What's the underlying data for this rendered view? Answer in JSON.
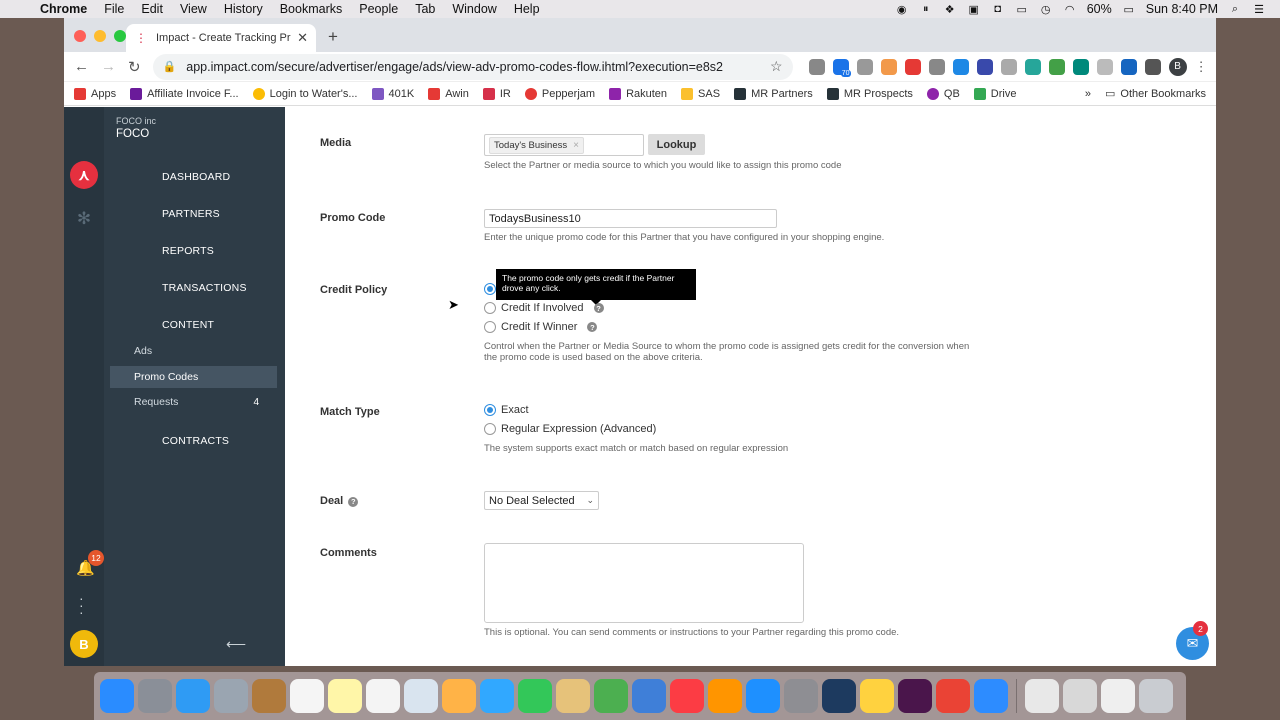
{
  "menubar": {
    "app": "Chrome",
    "items": [
      "File",
      "Edit",
      "View",
      "History",
      "Bookmarks",
      "People",
      "Tab",
      "Window",
      "Help"
    ],
    "battery": "60%",
    "clock": "Sun 8:40 PM"
  },
  "browser": {
    "tab_title": "Impact - Create Tracking Prom",
    "url": "app.impact.com/secure/advertiser/engage/ads/view-adv-promo-codes-flow.ihtml?execution=e8s2",
    "ext_badge": "70",
    "profile_initial": "B",
    "bookmarks": [
      "Apps",
      "Affiliate Invoice F...",
      "Login to Water's...",
      "401K",
      "Awin",
      "IR",
      "Pepperjam",
      "Rakuten",
      "SAS",
      "MR Partners",
      "MR Prospects",
      "QB",
      "Drive"
    ],
    "more_bookmarks": "»",
    "other_bookmarks": "Other Bookmarks"
  },
  "sidebar": {
    "org": "FOCO inc",
    "org_name": "FOCO",
    "nav": [
      "DASHBOARD",
      "PARTNERS",
      "REPORTS",
      "TRANSACTIONS",
      "CONTENT"
    ],
    "sub": [
      {
        "label": "Ads"
      },
      {
        "label": "Promo Codes"
      },
      {
        "label": "Requests",
        "count": "4"
      }
    ],
    "contracts": "CONTRACTS",
    "notifications": "12",
    "user_initial": "B"
  },
  "form": {
    "media": {
      "label": "Media",
      "tag": "Today's Business",
      "lookup": "Lookup",
      "help": "Select the Partner or media source to which you would like to assign this promo code"
    },
    "promo": {
      "label": "Promo Code",
      "value": "TodaysBusiness10",
      "help": "Enter the unique promo code for this Partner that you have configured in your shopping engine."
    },
    "credit": {
      "label": "Credit Policy",
      "tooltip": "The promo code only gets credit if the Partner drove any click.",
      "options": [
        "Credit If Involved",
        "Credit If Winner"
      ],
      "help": "Control when the Partner or Media Source to whom the promo code is assigned gets credit for the conversion when the promo code is used based on the above criteria."
    },
    "match": {
      "label": "Match Type",
      "options": [
        "Exact",
        "Regular Expression (Advanced)"
      ],
      "help": "The system supports exact match or match based on regular expression"
    },
    "deal": {
      "label": "Deal",
      "value": "No Deal Selected"
    },
    "comments": {
      "label": "Comments",
      "help": "This is optional. You can send comments or instructions to your Partner regarding this promo code."
    }
  },
  "chat_badge": "2"
}
